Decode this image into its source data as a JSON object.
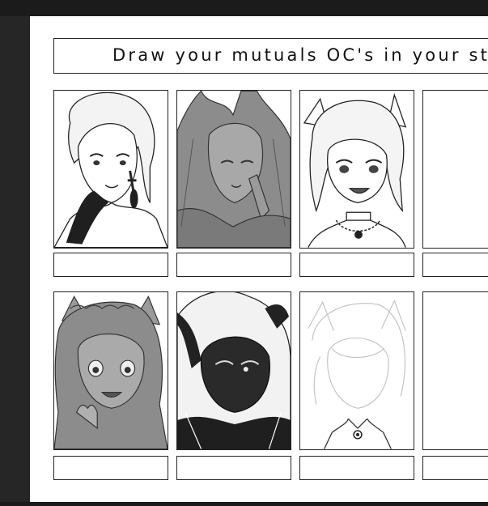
{
  "app": {
    "canvas_title": "Draw your mutuals OC's in your style"
  },
  "slots": [
    {
      "row": 1,
      "col": 1,
      "art": "drawn-portrait-light-hair-black-gloves",
      "name": ""
    },
    {
      "row": 1,
      "col": 2,
      "art": "drawn-portrait-gray-horned-ponytail",
      "name": ""
    },
    {
      "row": 1,
      "col": 3,
      "art": "drawn-portrait-catgirl-choker",
      "name": ""
    },
    {
      "row": 1,
      "col": 4,
      "art": "empty",
      "name": ""
    },
    {
      "row": 2,
      "col": 1,
      "art": "drawn-portrait-gray-catgirl-flower-crown",
      "name": ""
    },
    {
      "row": 2,
      "col": 2,
      "art": "drawn-portrait-horned-dark-mask",
      "name": ""
    },
    {
      "row": 2,
      "col": 3,
      "art": "sketch-portrait-faint-lines",
      "name": ""
    },
    {
      "row": 2,
      "col": 4,
      "art": "empty",
      "name": ""
    }
  ],
  "colors": {
    "app_background": "#262626",
    "canvas": "#ffffff",
    "line": "#222222",
    "gray_fill": "#8c8c8c",
    "dark_fill": "#2a2a2a"
  }
}
